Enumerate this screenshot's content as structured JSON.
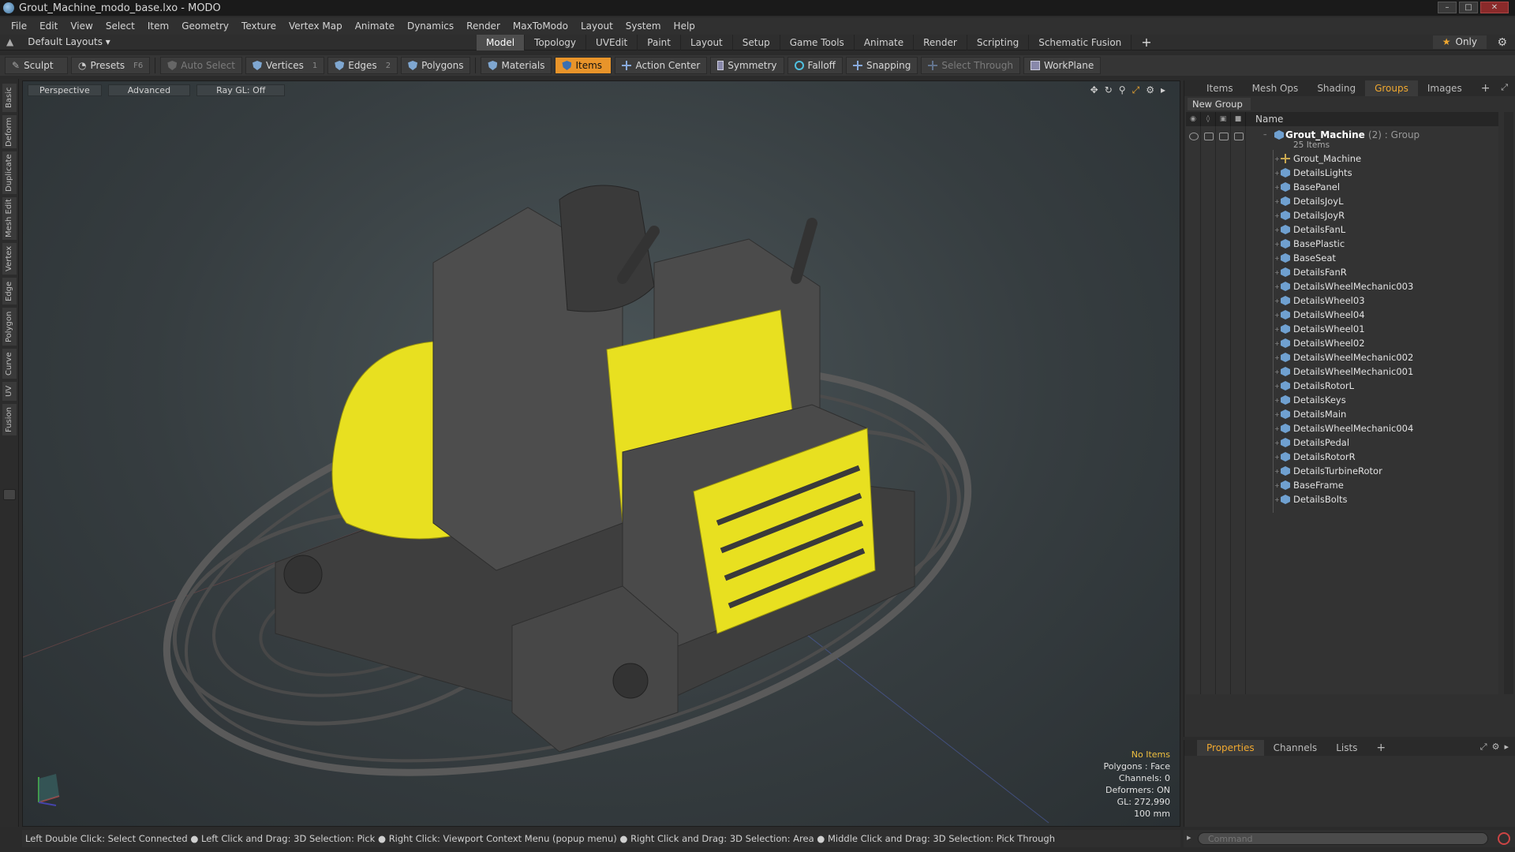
{
  "window": {
    "title": "Grout_Machine_modo_base.lxo - MODO"
  },
  "menu": [
    "File",
    "Edit",
    "View",
    "Select",
    "Item",
    "Geometry",
    "Texture",
    "Vertex Map",
    "Animate",
    "Dynamics",
    "Render",
    "MaxToModo",
    "Layout",
    "System",
    "Help"
  ],
  "layout": {
    "preset": "Default Layouts",
    "tabs": [
      "Model",
      "Topology",
      "UVEdit",
      "Paint",
      "Layout",
      "Setup",
      "Game Tools",
      "Animate",
      "Render",
      "Scripting",
      "Schematic Fusion"
    ],
    "active_tab": "Model",
    "only_label": "Only"
  },
  "toolbar": {
    "sculpt": "Sculpt",
    "presets": "Presets",
    "presets_key": "F6",
    "auto_select": "Auto Select",
    "vertices": "Vertices",
    "vertices_key": "1",
    "edges": "Edges",
    "edges_key": "2",
    "polygons": "Polygons",
    "materials": "Materials",
    "items": "Items",
    "action_center": "Action Center",
    "symmetry": "Symmetry",
    "falloff": "Falloff",
    "snapping": "Snapping",
    "select_through": "Select Through",
    "workplane": "WorkPlane"
  },
  "left_tabs": [
    "Basic",
    "Deform",
    "Duplicate",
    "Mesh Edit",
    "Vertex",
    "Edge",
    "Polygon",
    "Curve",
    "UV",
    "Fusion"
  ],
  "viewport": {
    "view": "Perspective",
    "advanced": "Advanced",
    "raygl": "Ray GL: Off",
    "info": {
      "no_items": "No Items",
      "polygons": "Polygons : Face",
      "channels": "Channels: 0",
      "deformers": "Deformers: ON",
      "gl": "GL: 272,990",
      "unit": "100 mm"
    }
  },
  "status": "Left Double Click: Select Connected ● Left Click and Drag: 3D Selection: Pick ● Right Click: Viewport Context Menu (popup menu) ● Right Click and Drag: 3D Selection: Area ● Middle Click and Drag: 3D Selection: Pick Through",
  "right_panel": {
    "tabs": [
      "Items",
      "Mesh Ops",
      "Shading",
      "Groups",
      "Images"
    ],
    "active_tab": "Groups",
    "new_group": "New Group",
    "name_header": "Name",
    "group": {
      "name": "Grout_Machine",
      "meta": "(2) : Group",
      "count": "25 Items"
    },
    "items": [
      "Grout_Machine",
      "DetailsLights",
      "BasePanel",
      "DetailsJoyL",
      "DetailsJoyR",
      "DetailsFanL",
      "BasePlastic",
      "BaseSeat",
      "DetailsFanR",
      "DetailsWheelMechanic003",
      "DetailsWheel03",
      "DetailsWheel04",
      "DetailsWheel01",
      "DetailsWheel02",
      "DetailsWheelMechanic002",
      "DetailsWheelMechanic001",
      "DetailsRotorL",
      "DetailsKeys",
      "DetailsMain",
      "DetailsWheelMechanic004",
      "DetailsPedal",
      "DetailsRotorR",
      "DetailsTurbineRotor",
      "BaseFrame",
      "DetailsBolts"
    ]
  },
  "props_panel": {
    "tabs": [
      "Properties",
      "Channels",
      "Lists"
    ],
    "active_tab": "Properties"
  },
  "command": {
    "placeholder": "Command"
  },
  "colors": {
    "accent": "#e8942a",
    "yellow": "#f2ea1c",
    "body": "#555555"
  }
}
